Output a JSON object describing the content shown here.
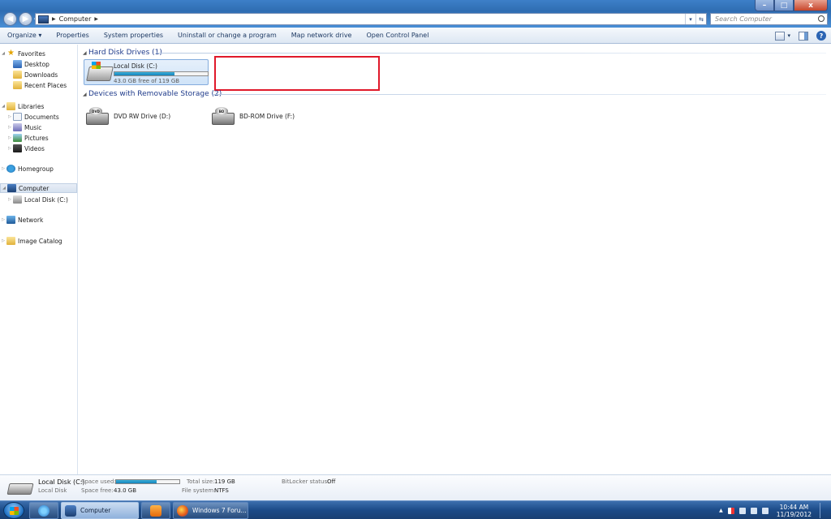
{
  "window": {
    "address_path": "Computer",
    "search_placeholder": "Search Computer",
    "min_glyph": "–",
    "max_glyph": "□",
    "close_glyph": "x"
  },
  "toolbar": {
    "organize": "Organize ▾",
    "properties": "Properties",
    "system_properties": "System properties",
    "uninstall": "Uninstall or change a program",
    "map_drive": "Map network drive",
    "control_panel": "Open Control Panel",
    "views_arrow": "▾",
    "help": "?"
  },
  "nav": {
    "favorites": "Favorites",
    "desktop": "Desktop",
    "downloads": "Downloads",
    "recent_places": "Recent Places",
    "libraries": "Libraries",
    "documents": "Documents",
    "music": "Music",
    "pictures": "Pictures",
    "videos": "Videos",
    "homegroup": "Homegroup",
    "computer": "Computer",
    "local_disk": "Local Disk (C:)",
    "network": "Network",
    "image_catalog": "Image Catalog"
  },
  "content": {
    "hdd_group": "Hard Disk Drives (1)",
    "removable_group": "Devices with Removable Storage (2)",
    "drive_c": {
      "name": "Local Disk (C:)",
      "free_text": "43.0 GB free of 119 GB",
      "used_fraction": 0.64
    },
    "dvd": "DVD RW Drive (D:)",
    "dvd_badge": "DVD",
    "bd": "BD-ROM Drive (F:)",
    "bd_badge": "BD"
  },
  "details": {
    "name": "Local Disk (C:)",
    "type": "Local Disk",
    "space_used_label": "Space used:",
    "space_used_fraction": 0.64,
    "space_free_label": "Space free:",
    "space_free": "43.0 GB",
    "total_size_label": "Total size:",
    "total_size": "119 GB",
    "file_system_label": "File system:",
    "file_system": "NTFS",
    "bitlocker_label": "BitLocker status:",
    "bitlocker": "Off"
  },
  "taskbar": {
    "explorer_label": "Computer",
    "firefox_label": "Windows 7 Foru...",
    "time": "10:44 AM",
    "date": "11/19/2012"
  }
}
